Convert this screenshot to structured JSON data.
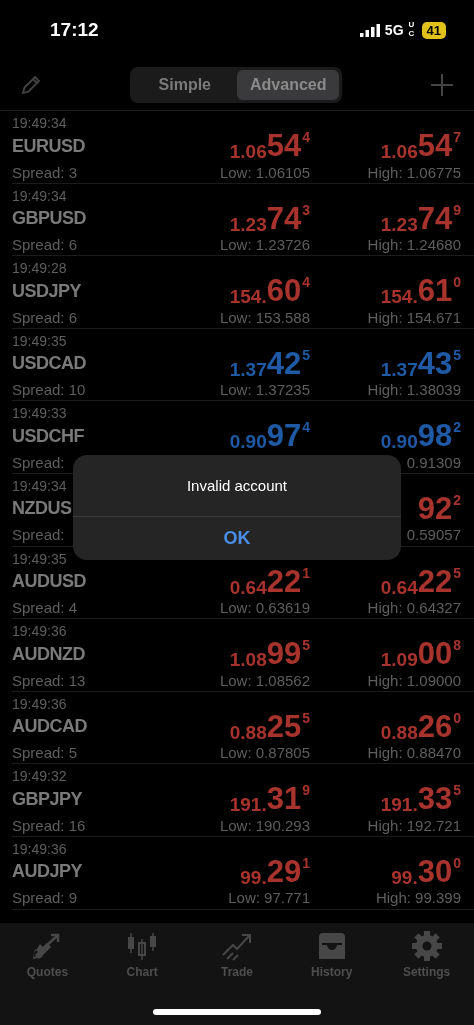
{
  "status_bar": {
    "time": "17:12",
    "network": "5G",
    "network_sub": "UC",
    "battery": "41"
  },
  "segments": [
    {
      "label": "Simple",
      "selected": false
    },
    {
      "label": "Advanced",
      "selected": true
    }
  ],
  "quotes": [
    {
      "time": "19:49:34",
      "symbol": "EURUSD",
      "spread": "Spread: 3",
      "bid": {
        "prefix": "1.06",
        "big": "54",
        "sup": "4",
        "color": "#a8332d"
      },
      "ask": {
        "prefix": "1.06",
        "big": "54",
        "sup": "7",
        "color": "#a8332d"
      },
      "low": "Low: 1.06105",
      "high": "High: 1.06775"
    },
    {
      "time": "19:49:34",
      "symbol": "GBPUSD",
      "spread": "Spread: 6",
      "bid": {
        "prefix": "1.23",
        "big": "74",
        "sup": "3",
        "color": "#a8332d"
      },
      "ask": {
        "prefix": "1.23",
        "big": "74",
        "sup": "9",
        "color": "#a8332d"
      },
      "low": "Low: 1.23726",
      "high": "High: 1.24680"
    },
    {
      "time": "19:49:28",
      "symbol": "USDJPY",
      "spread": "Spread: 6",
      "bid": {
        "prefix": "154.",
        "big": "60",
        "sup": "4",
        "color": "#a8332d"
      },
      "ask": {
        "prefix": "154.",
        "big": "61",
        "sup": "0",
        "color": "#a8332d"
      },
      "low": "Low: 153.588",
      "high": "High: 154.671"
    },
    {
      "time": "19:49:35",
      "symbol": "USDCAD",
      "spread": "Spread: 10",
      "bid": {
        "prefix": "1.37",
        "big": "42",
        "sup": "5",
        "color": "#1f5aa6"
      },
      "ask": {
        "prefix": "1.37",
        "big": "43",
        "sup": "5",
        "color": "#1f5aa6"
      },
      "low": "Low: 1.37235",
      "high": "High: 1.38039"
    },
    {
      "time": "19:49:33",
      "symbol": "USDCHF",
      "spread": "Spread:",
      "bid": {
        "prefix": "0.90",
        "big": "97",
        "sup": "4",
        "color": "#1f5aa6"
      },
      "ask": {
        "prefix": "0.90",
        "big": "98",
        "sup": "2",
        "color": "#1f5aa6"
      },
      "high": "0.91309"
    },
    {
      "time": "19:49:34",
      "symbol": "NZDUS",
      "spread": "Spread:",
      "ask": {
        "big": "92",
        "sup": "2",
        "color": "#a8332d"
      },
      "high": "0.59057"
    },
    {
      "time": "19:49:35",
      "symbol": "AUDUSD",
      "spread": "Spread: 4",
      "bid": {
        "prefix": "0.64",
        "big": "22",
        "sup": "1",
        "color": "#a8332d"
      },
      "ask": {
        "prefix": "0.64",
        "big": "22",
        "sup": "5",
        "color": "#a8332d"
      },
      "low": "Low: 0.63619",
      "high": "High: 0.64327"
    },
    {
      "time": "19:49:36",
      "symbol": "AUDNZD",
      "spread": "Spread: 13",
      "bid": {
        "prefix": "1.08",
        "big": "99",
        "sup": "5",
        "color": "#a8332d"
      },
      "ask": {
        "prefix": "1.09",
        "big": "00",
        "sup": "8",
        "color": "#a8332d"
      },
      "low": "Low: 1.08562",
      "high": "High: 1.09000"
    },
    {
      "time": "19:49:36",
      "symbol": "AUDCAD",
      "spread": "Spread: 5",
      "bid": {
        "prefix": "0.88",
        "big": "25",
        "sup": "5",
        "color": "#a8332d"
      },
      "ask": {
        "prefix": "0.88",
        "big": "26",
        "sup": "0",
        "color": "#a8332d"
      },
      "low": "Low: 0.87805",
      "high": "High: 0.88470"
    },
    {
      "time": "19:49:32",
      "symbol": "GBPJPY",
      "spread": "Spread: 16",
      "bid": {
        "prefix": "191.",
        "big": "31",
        "sup": "9",
        "color": "#a8332d"
      },
      "ask": {
        "prefix": "191.",
        "big": "33",
        "sup": "5",
        "color": "#a8332d"
      },
      "low": "Low: 190.293",
      "high": "High: 192.721"
    },
    {
      "time": "19:49:36",
      "symbol": "AUDJPY",
      "spread": "Spread: 9",
      "bid": {
        "prefix": "99.",
        "big": "29",
        "sup": "1",
        "color": "#a8332d"
      },
      "ask": {
        "prefix": "99.",
        "big": "30",
        "sup": "0",
        "color": "#a8332d"
      },
      "low": "Low: 97.771",
      "high": "High: 99.399"
    }
  ],
  "alert": {
    "message": "Invalid account",
    "button": "OK"
  },
  "tab_bar": [
    {
      "label": "Quotes",
      "kind": "quotes"
    },
    {
      "label": "Chart",
      "kind": "chart"
    },
    {
      "label": "Trade",
      "kind": "trade"
    },
    {
      "label": "History",
      "kind": "history"
    },
    {
      "label": "Settings",
      "kind": "settings"
    }
  ]
}
